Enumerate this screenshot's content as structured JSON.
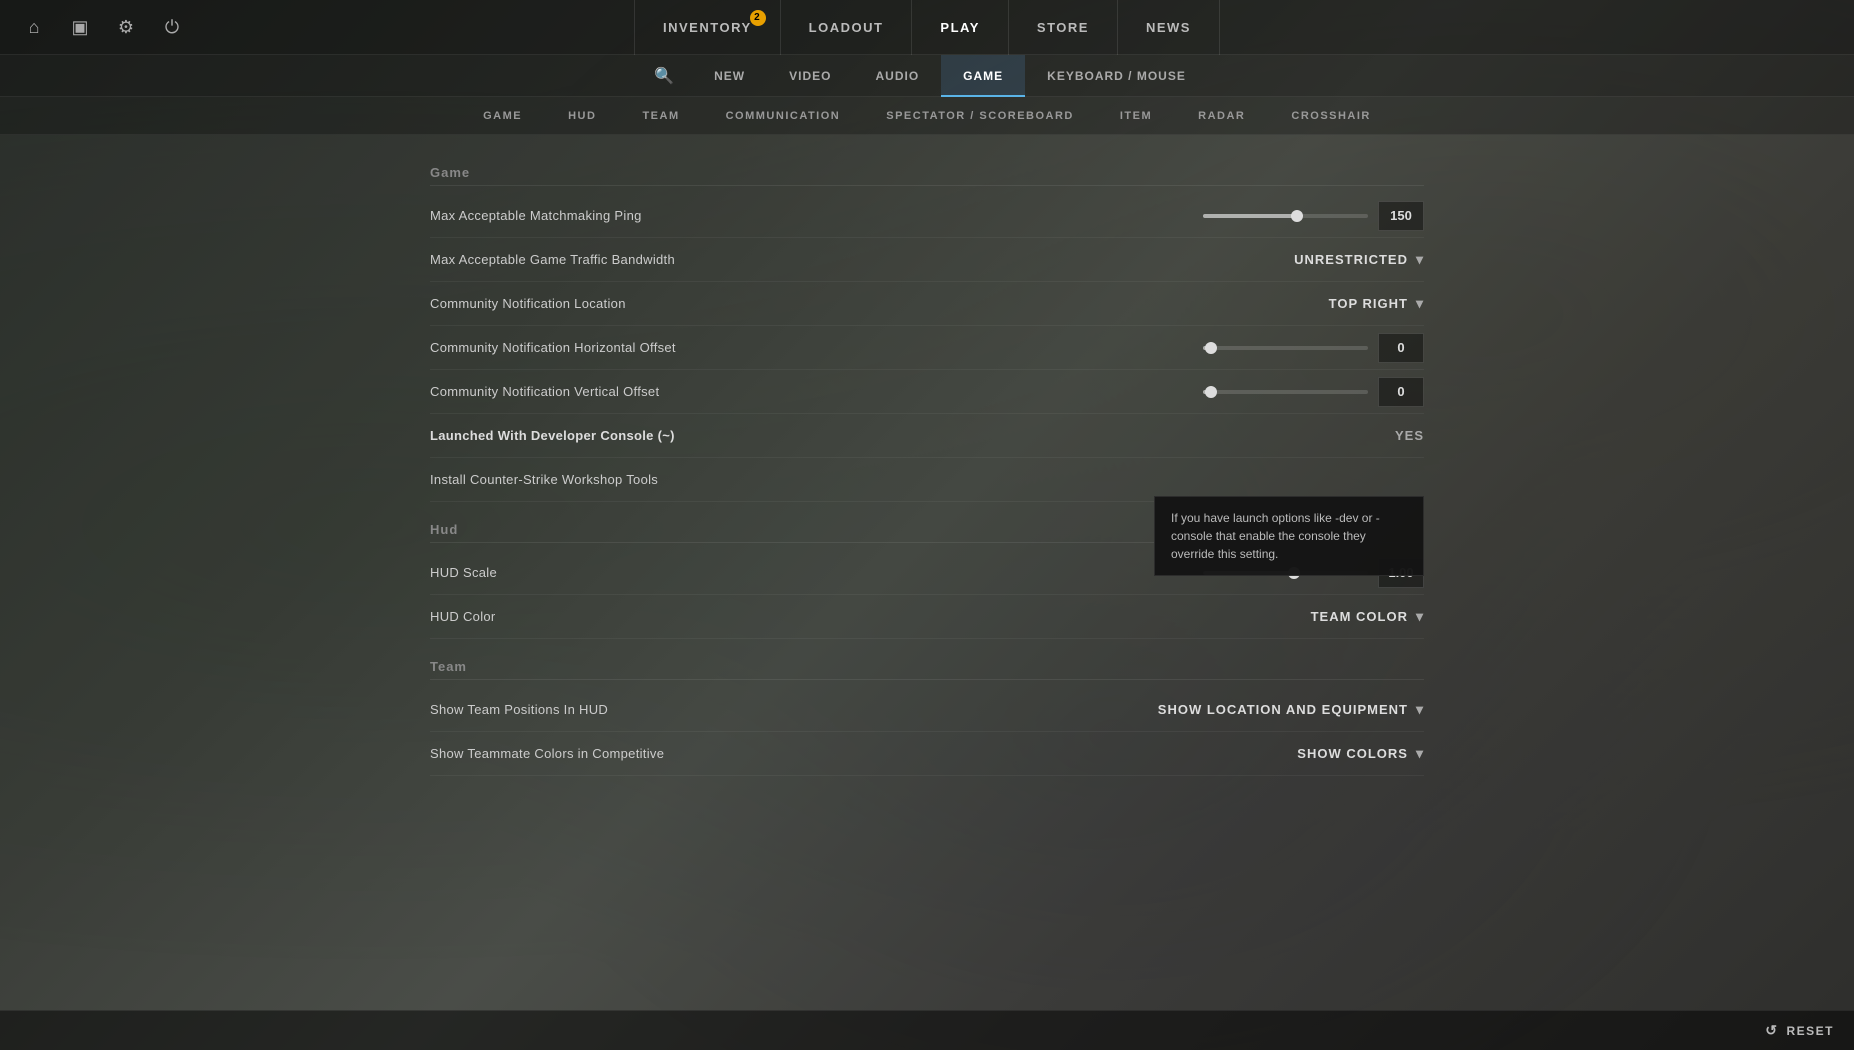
{
  "nav": {
    "items": [
      {
        "id": "inventory",
        "label": "INVENTORY",
        "badge": "2",
        "active": false
      },
      {
        "id": "loadout",
        "label": "LOADOUT",
        "badge": null,
        "active": false
      },
      {
        "id": "play",
        "label": "PLAY",
        "badge": null,
        "active": true
      },
      {
        "id": "store",
        "label": "STORE",
        "badge": null,
        "active": false
      },
      {
        "id": "news",
        "label": "NEWS",
        "badge": null,
        "active": false
      }
    ]
  },
  "settings_tabs": [
    {
      "id": "new",
      "label": "NEW",
      "active": false
    },
    {
      "id": "video",
      "label": "VIDEO",
      "active": false
    },
    {
      "id": "audio",
      "label": "AUDIO",
      "active": false
    },
    {
      "id": "game",
      "label": "GAME",
      "active": true
    },
    {
      "id": "keyboard-mouse",
      "label": "KEYBOARD / MOUSE",
      "active": false
    }
  ],
  "sub_tabs": [
    {
      "id": "game",
      "label": "GAME"
    },
    {
      "id": "hud",
      "label": "HUD"
    },
    {
      "id": "team",
      "label": "TEAM"
    },
    {
      "id": "communication",
      "label": "COMMUNICATION"
    },
    {
      "id": "spectator-scoreboard",
      "label": "SPECTATOR / SCOREBOARD"
    },
    {
      "id": "item",
      "label": "ITEM"
    },
    {
      "id": "radar",
      "label": "RADAR"
    },
    {
      "id": "crosshair",
      "label": "CROSSHAIR"
    }
  ],
  "sections": {
    "game": {
      "title": "Game",
      "settings": [
        {
          "id": "max-ping",
          "label": "Max Acceptable Matchmaking Ping",
          "type": "slider",
          "value": "150",
          "slider_pct": 57
        },
        {
          "id": "bandwidth",
          "label": "Max Acceptable Game Traffic Bandwidth",
          "type": "dropdown",
          "value": "UNRESTRICTED"
        },
        {
          "id": "notification-location",
          "label": "Community Notification Location",
          "type": "dropdown",
          "value": "TOP RIGHT"
        },
        {
          "id": "notification-horizontal",
          "label": "Community Notification Horizontal Offset",
          "type": "slider",
          "value": "0",
          "slider_pct": 5
        },
        {
          "id": "notification-vertical",
          "label": "Community Notification Vertical Offset",
          "type": "slider",
          "value": "0",
          "slider_pct": 5
        },
        {
          "id": "developer-console",
          "label": "Launched With Developer Console (~)",
          "type": "yesno",
          "value": "YES",
          "bold": true
        },
        {
          "id": "workshop-tools",
          "label": "Install Counter-Strike Workshop Tools",
          "type": "none",
          "tooltip": "If you have launch options like -dev or -console that enable the console they override this setting."
        }
      ]
    },
    "hud": {
      "title": "Hud",
      "settings": [
        {
          "id": "hud-scale",
          "label": "HUD Scale",
          "type": "slider",
          "value": "1.00",
          "slider_pct": 55
        },
        {
          "id": "hud-color",
          "label": "HUD Color",
          "type": "dropdown",
          "value": "TEAM COLOR"
        }
      ]
    },
    "team": {
      "title": "Team",
      "settings": [
        {
          "id": "team-positions",
          "label": "Show Team Positions In HUD",
          "type": "dropdown",
          "value": "SHOW LOCATION AND EQUIPMENT"
        },
        {
          "id": "teammate-colors",
          "label": "Show Teammate Colors in Competitive",
          "type": "dropdown",
          "value": "SHOW COLORS"
        }
      ]
    }
  },
  "bottom": {
    "reset_label": "RESET",
    "reset_icon": "↺"
  },
  "icons": {
    "home": "⌂",
    "missions": "▣",
    "settings": "⚙",
    "power": "⏻",
    "search": "🔍",
    "dropdown_arrow": "▾",
    "reset": "↺"
  }
}
